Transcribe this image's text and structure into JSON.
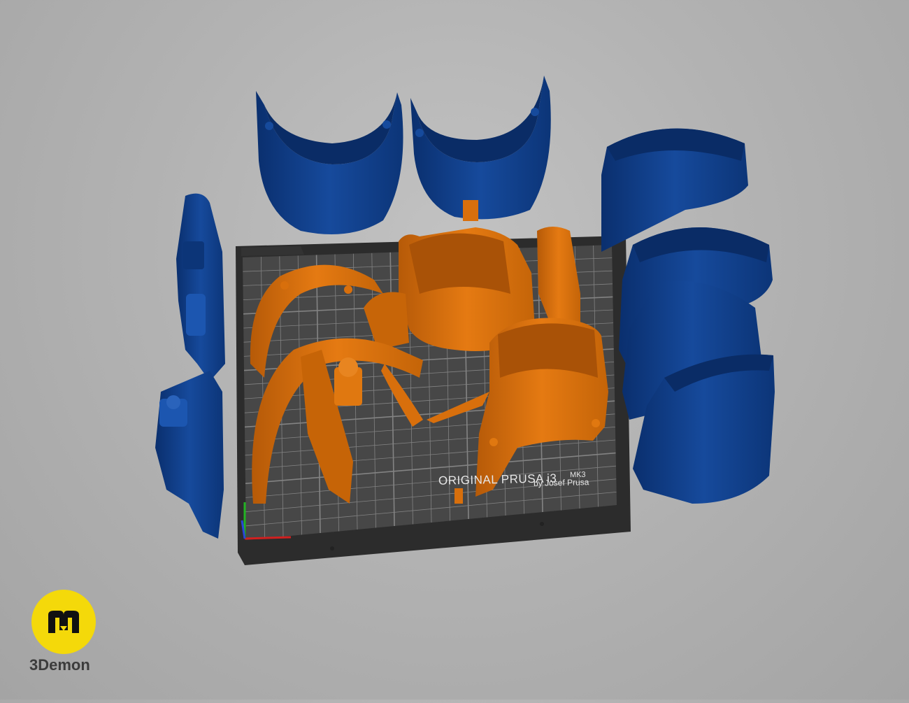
{
  "scene": {
    "background_color": "#b3b3b3",
    "part_colors": {
      "selected": "#d86f0c",
      "unselected": "#0e3a82"
    }
  },
  "print_bed": {
    "title": "ORIGINAL PRUSA i3",
    "model": "MK3",
    "subtitle": "by Josef Prusa",
    "surface_color": "#454545",
    "grid_color": "#8c8c8c"
  },
  "branding": {
    "logo_icon": "3demon-logo-icon",
    "logo_color": "#f4d90a",
    "name": "3Demon"
  }
}
